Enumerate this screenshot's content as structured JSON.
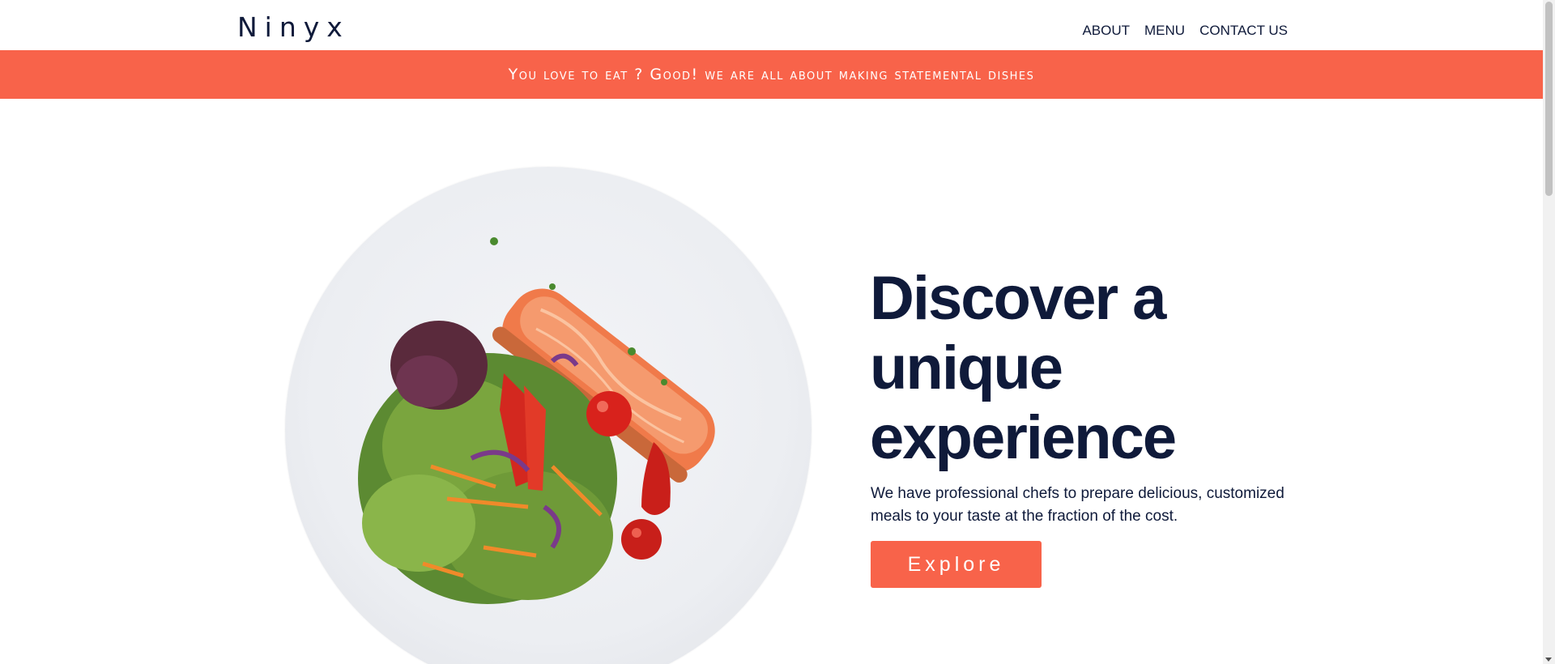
{
  "header": {
    "logo": "Ninyx",
    "nav": [
      {
        "label": "ABOUT"
      },
      {
        "label": "MENU"
      },
      {
        "label": "CONTACT US"
      }
    ]
  },
  "banner": {
    "text": "You love to eat ? Good! we are all about making statemental dishes"
  },
  "hero": {
    "title": "Discover a unique experience",
    "description": "We have professional chefs to prepare delicious, customized meals to your taste at the fraction of the cost.",
    "button_label": "Explore"
  },
  "colors": {
    "accent": "#f8634a",
    "text": "#0f1a3a"
  }
}
